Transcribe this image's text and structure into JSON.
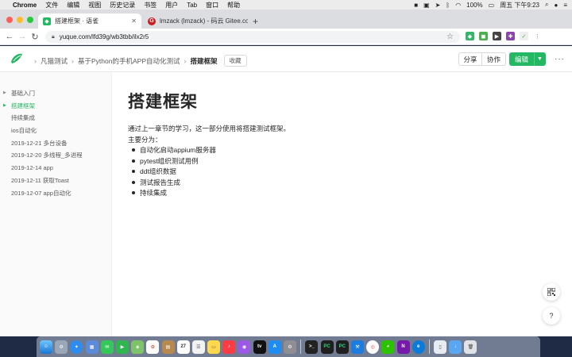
{
  "menubar": {
    "app": "Chrome",
    "items": [
      "文件",
      "编辑",
      "视图",
      "历史记录",
      "书签",
      "用户",
      "Tab",
      "窗口",
      "帮助"
    ],
    "battery": "100%",
    "clock": "周五 下午9:23"
  },
  "tabs": [
    {
      "title": "搭建框架 · 语雀",
      "favicon_color": "#25b864",
      "active": true
    },
    {
      "title": "lmzack (lmzack) - 码云 Gitee.co",
      "favicon_color": "#c71d23",
      "favicon_text": "G",
      "active": false
    }
  ],
  "addressbar": {
    "url": "yuque.com/lfd39g/wb3tbb/ilx2r5"
  },
  "header": {
    "breadcrumbs": [
      "凡猫测试",
      "基于Python的手机APP自动化测试"
    ],
    "current": "搭建框架",
    "favorite_label": "收藏",
    "share_label": "分享",
    "collab_label": "协作",
    "edit_label": "编辑",
    "more_label": "···",
    "accent_color": "#25b864"
  },
  "sidebar": {
    "items": [
      {
        "label": "基础入门",
        "caret": true,
        "active": false
      },
      {
        "label": "搭建框架",
        "caret": true,
        "active": true
      },
      {
        "label": "持续集成",
        "caret": false,
        "active": false
      },
      {
        "label": "ios自动化",
        "caret": false,
        "active": false
      },
      {
        "label": "2019-12-21 多台设备",
        "caret": false,
        "active": false
      },
      {
        "label": "2019-12-20 多线程_多进程",
        "caret": false,
        "active": false
      },
      {
        "label": "2019-12-14 app",
        "caret": false,
        "active": false
      },
      {
        "label": "2019-12-11 获取Toast",
        "caret": false,
        "active": false
      },
      {
        "label": "2019-12-07 app自动化",
        "caret": false,
        "active": false
      }
    ]
  },
  "document": {
    "title": "搭建框架",
    "intro": "通过上一章节的学习，这一部分使用将搭建测试框架。",
    "lead": "主要分为：",
    "bullets": [
      "自动化启动appium服务器",
      "pytest组织测试用例",
      "ddt组织数据",
      "测试报告生成",
      "持续集成"
    ]
  },
  "floating": {
    "qr_icon": "qr-code-icon",
    "help_label": "?"
  },
  "dock": {
    "icons": [
      "finder-icon",
      "launchpad-icon",
      "safari-icon",
      "preview-icon",
      "messages-icon",
      "facetime-icon",
      "maps-icon",
      "photos-icon",
      "notes-icon",
      "calendar-icon",
      "reminders-icon",
      "stickies-icon",
      "music-icon",
      "podcasts-icon",
      "tv-icon",
      "appstore-icon",
      "settings-icon",
      "terminal-icon",
      "pycharm-icon",
      "pycharm-ce-icon",
      "xcode-icon",
      "chrome-icon",
      "wechat-icon",
      "onenote-icon",
      "edge-icon",
      "documents-icon",
      "downloads-icon",
      "trash-icon"
    ],
    "calendar_day": "27"
  }
}
